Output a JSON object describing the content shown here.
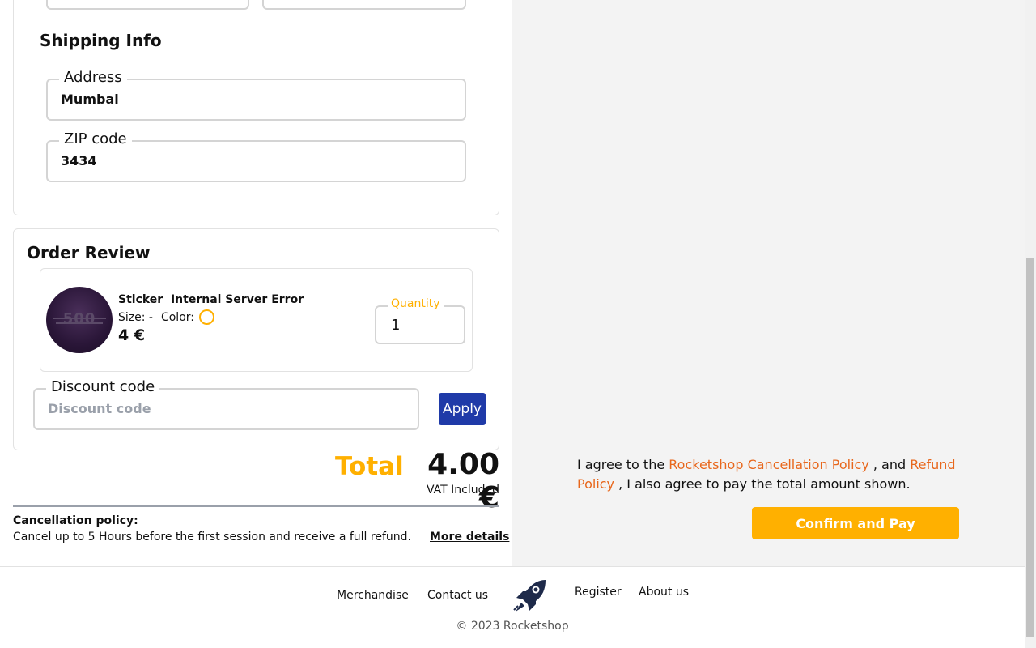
{
  "shipping": {
    "title": "Shipping Info",
    "address": {
      "label": "Address",
      "value": "Mumbai"
    },
    "zip": {
      "label": "ZIP code",
      "value": "3434"
    }
  },
  "order": {
    "title": "Order Review",
    "item": {
      "name": "Sticker  Internal Server Error",
      "size_label": "Size: -",
      "color_label": "Color:",
      "color_swatch": "#ffb000",
      "price": "4 €",
      "image_text": "500"
    },
    "quantity": {
      "label": "Quantity",
      "value": "1"
    },
    "discount": {
      "label": "Discount code",
      "placeholder": "Discount code",
      "apply_label": "Apply"
    }
  },
  "total": {
    "label": "Total",
    "value": "4.00 €",
    "vat": "VAT Included"
  },
  "policy": {
    "title": "Cancellation policy:",
    "text": "Cancel up to 5 Hours before the first session and receive a full refund.",
    "more_details": "More details"
  },
  "agreement": {
    "prefix": "I agree to the",
    "cancellation_link": "Rocketshop Cancellation Policy",
    "middle": ", and",
    "refund_link": "Refund Policy",
    "suffix": ", I also agree to pay the total amount shown."
  },
  "confirm_label": "Confirm and Pay",
  "footer": {
    "links": [
      "Merchandise",
      "Contact us",
      "Register",
      "About us"
    ],
    "copyright": "© 2023 Rocketshop"
  },
  "colors": {
    "accent": "#ffb000",
    "link": "#e8671c",
    "primary_button": "#1f3aa8"
  }
}
